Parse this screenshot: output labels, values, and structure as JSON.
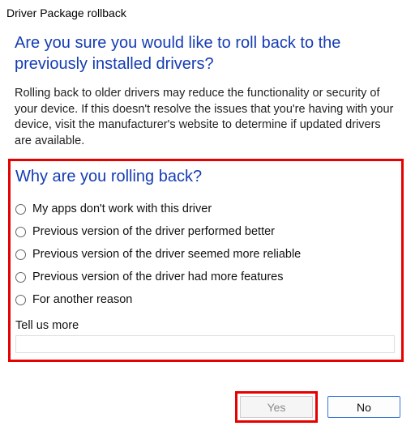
{
  "titlebar": "Driver Package rollback",
  "main": {
    "heading": "Are you sure you would like to roll back to the previously installed drivers?",
    "info": "Rolling back to older drivers may reduce the functionality or security of your device. If this doesn't resolve the issues that you're having with your device, visit the manufacturer's website to determine if updated drivers are available."
  },
  "survey": {
    "heading": "Why are you rolling back?",
    "options": [
      "My apps don't work with this driver",
      "Previous version of the driver performed better",
      "Previous version of the driver seemed more reliable",
      "Previous version of the driver had more features",
      "For another reason"
    ],
    "tell_us_label": "Tell us more",
    "tell_us_value": ""
  },
  "buttons": {
    "yes": "Yes",
    "no": "No"
  },
  "highlights": {
    "color": "#e60000"
  }
}
